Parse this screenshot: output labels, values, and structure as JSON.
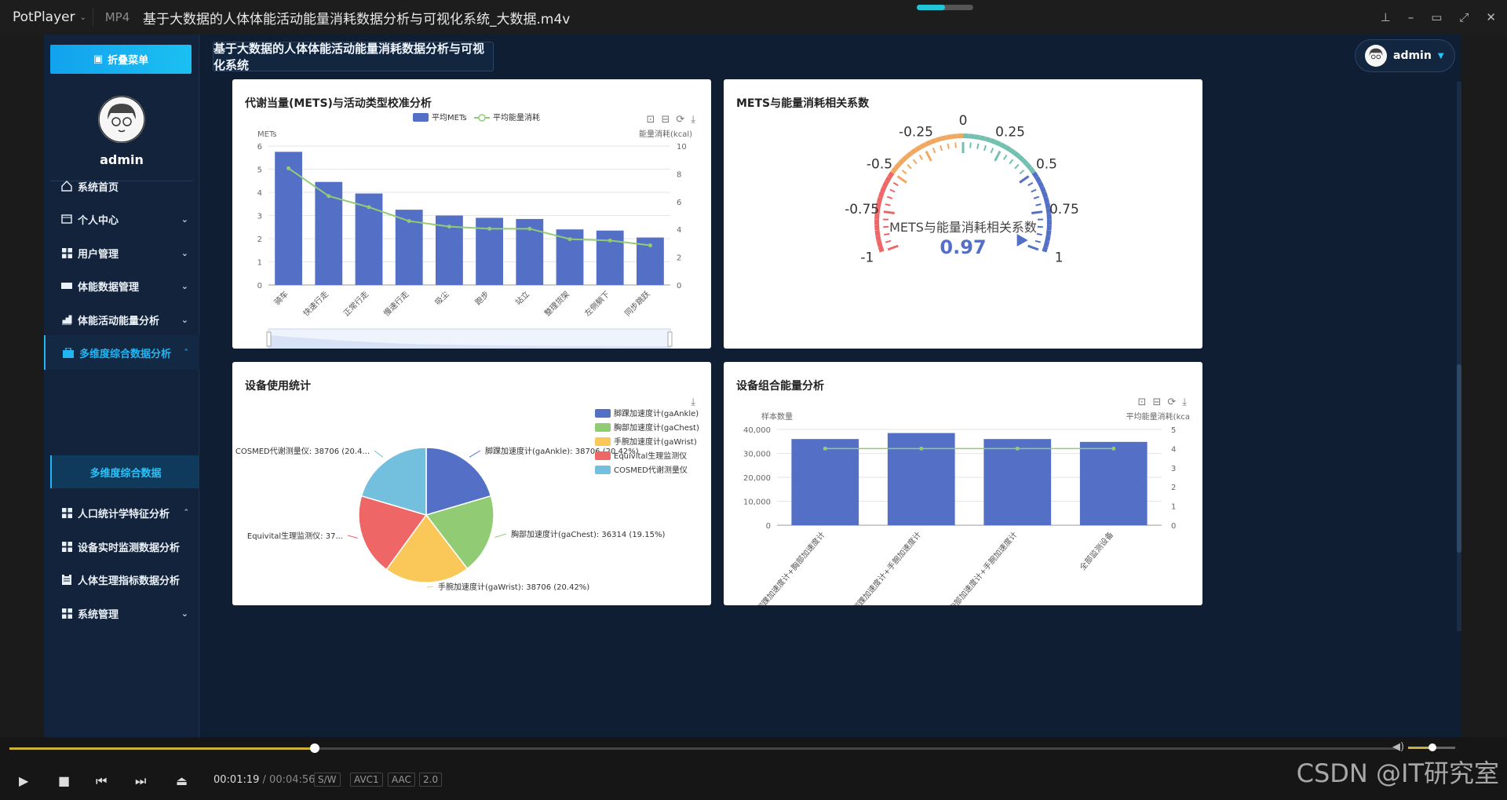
{
  "player": {
    "brand": "PotPlayer",
    "format": "MP4",
    "file_title": "基于大数据的人体体能活动能量消耗数据分析与可视化系统_大数据.m4v",
    "time_current": "00:01:19",
    "time_total": "00:04:56",
    "tags": [
      "S/W",
      "AVC1",
      "AAC",
      "2.0"
    ],
    "progress": 0.22,
    "watermark": "CSDN @IT研究室"
  },
  "sidebar": {
    "collapse_label": "折叠菜单",
    "username": "admin",
    "items": [
      {
        "label": "系统首页",
        "icon": "home-icon",
        "has_chevron": false
      },
      {
        "label": "个人中心",
        "icon": "profile-icon",
        "has_chevron": true
      },
      {
        "label": "用户管理",
        "icon": "grid-icon",
        "has_chevron": true
      },
      {
        "label": "体能数据管理",
        "icon": "data-icon",
        "has_chevron": true
      },
      {
        "label": "体能活动能量分析",
        "icon": "chart-icon",
        "has_chevron": true
      },
      {
        "label": "多维度综合数据分析",
        "icon": "briefcase-icon",
        "has_chevron": true,
        "active": true
      },
      {
        "label": "人口统计学特征分析",
        "icon": "grid-icon",
        "has_chevron": true
      },
      {
        "label": "设备实时监测数据分析",
        "icon": "grid-icon",
        "has_chevron": false
      },
      {
        "label": "人体生理指标数据分析",
        "icon": "clipboard-icon",
        "has_chevron": false
      },
      {
        "label": "系统管理",
        "icon": "grid-icon",
        "has_chevron": true
      }
    ],
    "sub_item": "多维度综合数据"
  },
  "header": {
    "title": "基于大数据的人体体能活动能量消耗数据分析与可视化系统",
    "user": "admin"
  },
  "panels": {
    "mets": {
      "title": "代谢当量(METS)与活动类型校准分析"
    },
    "gauge": {
      "title": "METS与能量消耗相关系数"
    },
    "device": {
      "title": "设备使用统计"
    },
    "combo": {
      "title": "设备组合能量分析"
    }
  },
  "chart_data": [
    {
      "type": "bar",
      "title": "代谢当量(METS)与活动类型校准分析",
      "categories": [
        "骑车",
        "快速行走",
        "正常行走",
        "慢速行走",
        "吸尘",
        "跑步",
        "站立",
        "整理货架",
        "左侧躺下",
        "同步跳跃"
      ],
      "series": [
        {
          "name": "平均METs",
          "type": "bar",
          "axis": "left",
          "values": [
            5.75,
            4.45,
            3.95,
            3.25,
            3.0,
            2.9,
            2.85,
            2.4,
            2.35,
            2.05
          ]
        },
        {
          "name": "平均能量消耗",
          "type": "line",
          "axis": "right",
          "values": [
            8.4,
            6.4,
            5.6,
            4.6,
            4.2,
            4.05,
            4.05,
            3.3,
            3.2,
            2.85
          ]
        }
      ],
      "ylabel": "METs",
      "ylabel_right": "能量消耗(kcal)",
      "ylim": [
        0,
        6
      ],
      "ylim_right": [
        0,
        10
      ],
      "yticks": [
        "0",
        "1",
        "2",
        "3",
        "4",
        "5",
        "6"
      ],
      "yticks_right": [
        "0",
        "2",
        "4",
        "6",
        "8",
        "10"
      ],
      "legend": "top-center",
      "grid": true
    },
    {
      "type": "gauge",
      "title": "METS与能量消耗相关系数",
      "value": 0.97,
      "value_label": "0.97",
      "range": [
        -1,
        1
      ],
      "ticks": [
        "-1",
        "-0.75",
        "-0.5",
        "-0.25",
        "0",
        "0.25",
        "0.5",
        "0.75",
        "1"
      ],
      "center_label": "METS与能量消耗相关系数"
    },
    {
      "type": "pie",
      "title": "设备使用统计",
      "slices": [
        {
          "name": "脚踝加速度计(gaAnkle)",
          "value": 38706,
          "label": "脚踝加速度计(gaAnkle): 38706 (20.42%)",
          "color": "#5470c6"
        },
        {
          "name": "胸部加速度计(gaChest)",
          "value": 36314,
          "label": "胸部加速度计(gaChest): 36314 (19.15%)",
          "color": "#91cc75"
        },
        {
          "name": "手腕加速度计(gaWrist)",
          "value": 38706,
          "label": "手腕加速度计(gaWrist): 38706 (20.42%)",
          "color": "#fac858"
        },
        {
          "name": "Equivital生理监测仪",
          "value": 37000,
          "label": "Equivital生理监测仪: 37...",
          "color": "#ee6666"
        },
        {
          "name": "COSMED代谢测量仪",
          "value": 38706,
          "label": "COSMED代谢测量仪: 38706 (20.4...",
          "color": "#73c0de"
        }
      ],
      "legend": "right"
    },
    {
      "type": "bar",
      "title": "设备组合能量分析",
      "categories": [
        "脚踝加速度计+胸部加速度计",
        "脚踝加速度计+手腕加速度计",
        "胸部加速度计+手腕加速度计",
        "全部监测设备"
      ],
      "series": [
        {
          "name": "样本数量",
          "type": "bar",
          "axis": "left",
          "values": [
            36000,
            38500,
            36000,
            34800
          ]
        },
        {
          "name": "平均能量消耗",
          "type": "line",
          "axis": "right",
          "values": [
            4.0,
            4.0,
            4.0,
            4.0
          ]
        }
      ],
      "ylabel": "样本数量",
      "ylabel_right": "平均能量消耗(kca",
      "ylim": [
        0,
        40000
      ],
      "ylim_right": [
        0,
        5
      ],
      "yticks": [
        "0",
        "10,000",
        "20,000",
        "30,000",
        "40,000"
      ],
      "yticks_right": [
        "0",
        "1",
        "2",
        "3",
        "4",
        "5"
      ],
      "grid": true
    }
  ],
  "colors": {
    "accent": "#21b6f3",
    "bar": "#5470c6",
    "line": "#91cc75"
  }
}
